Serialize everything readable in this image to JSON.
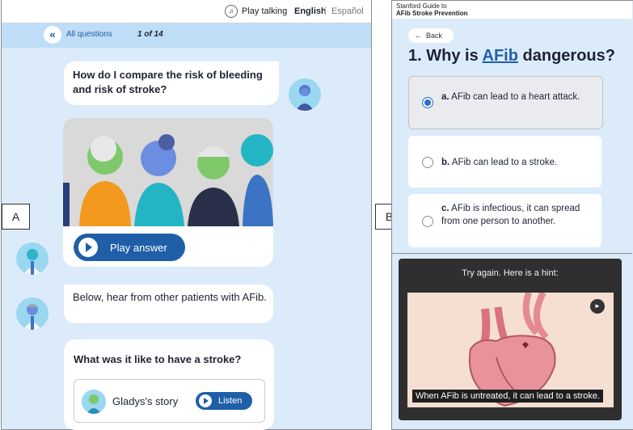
{
  "panelA": {
    "tag": "A",
    "topbar": {
      "play_talking": "Play talking",
      "lang_en": "English",
      "lang_sep": "|",
      "lang_es": "Español"
    },
    "qbar": {
      "back_icon": "«",
      "all_questions": "All questions",
      "counter": "1 of 14"
    },
    "question": "How do I compare the risk of bleeding and risk of stroke?",
    "play_answer": "Play answer",
    "patients_note": "Below, hear from other patients with AFib.",
    "stroke_question": "What was it like to have a stroke?",
    "story": {
      "label": "Gladys's story",
      "listen": "Listen"
    },
    "icons": {
      "speaker": "speaker-icon",
      "back": "double-chevron-left-icon",
      "play": "play-icon"
    }
  },
  "panelB": {
    "tag": "B",
    "brand_line1": "Stanford Guide to",
    "brand_line2": "AFib Stroke Prevention",
    "back": "Back",
    "question_prefix": "1. Why is ",
    "question_link": "AFib",
    "question_suffix": " dangerous?",
    "options": [
      {
        "letter": "a.",
        "text": " AFib can lead to a heart attack.",
        "selected": true
      },
      {
        "letter": "b.",
        "text": " AFib can lead to a stroke.",
        "selected": false
      },
      {
        "letter": "c.",
        "text": " AFib is infectious, it can spread from one person to another.",
        "selected": false
      }
    ],
    "hint_title": "Try again. Here is a hint:",
    "caption": "When AFib is untreated, it can lead to a stroke.",
    "volume_icon": "volume-icon"
  },
  "colors": {
    "accent": "#1f5fa8",
    "panel_bg": "#dcebfa",
    "selected_radio": "#2e6fd2",
    "hint_bg": "#2f2f2f"
  }
}
